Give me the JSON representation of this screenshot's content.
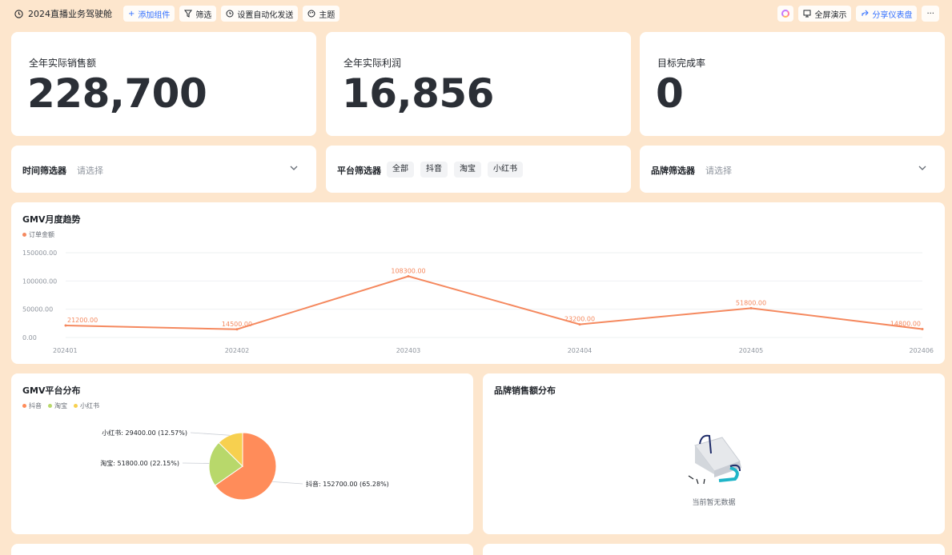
{
  "topbar": {
    "title": "2024直播业务驾驶舱",
    "add_widget": "添加组件",
    "filter": "筛选",
    "automation": "设置自动化发送",
    "theme": "主题",
    "fullscreen": "全屏演示",
    "share": "分享仪表盘",
    "more": "···"
  },
  "kpis": [
    {
      "label": "全年实际销售额",
      "value": "228,700"
    },
    {
      "label": "全年实际利润",
      "value": "16,856"
    },
    {
      "label": "目标完成率",
      "value": "0"
    }
  ],
  "filters": {
    "time": {
      "label": "时间筛选器",
      "placeholder": "请选择"
    },
    "platform": {
      "label": "平台筛选器",
      "options": [
        "全部",
        "抖音",
        "淘宝",
        "小红书"
      ]
    },
    "brand": {
      "label": "品牌筛选器",
      "placeholder": "请选择"
    }
  },
  "line_card": {
    "title": "GMV月度趋势"
  },
  "pie_card": {
    "title": "GMV平台分布"
  },
  "brand_card": {
    "title": "品牌销售额分布",
    "empty_text": "当前暂无数据"
  },
  "colors": {
    "line": "#f5895f",
    "pie": [
      "#ff8c5a",
      "#b8d86b",
      "#f7d04f"
    ]
  },
  "chart_data": [
    {
      "type": "line",
      "title": "GMV月度趋势",
      "x": [
        "202401",
        "202402",
        "202403",
        "202404",
        "202405",
        "202406"
      ],
      "series": [
        {
          "name": "订单金额",
          "values": [
            21200,
            14500,
            108300,
            23200,
            51800,
            14800
          ]
        }
      ],
      "data_labels": [
        "21200.00",
        "14500.00",
        "108300.00",
        "23200.00",
        "51800.00",
        "14800.00"
      ],
      "yticks": [
        "0.00",
        "50000.00",
        "100000.00",
        "150000.00"
      ],
      "ylim": [
        0,
        150000
      ],
      "grid": true,
      "legend": "top-left"
    },
    {
      "type": "pie",
      "title": "GMV平台分布",
      "categories": [
        "抖音",
        "淘宝",
        "小红书"
      ],
      "values": [
        152700,
        51800,
        29400
      ],
      "labels": [
        "抖音: 152700.00 (65.28%)",
        "淘宝: 51800.00 (22.15%)",
        "小红书: 29400.00 (12.57%)"
      ],
      "legend": "top-left"
    }
  ]
}
